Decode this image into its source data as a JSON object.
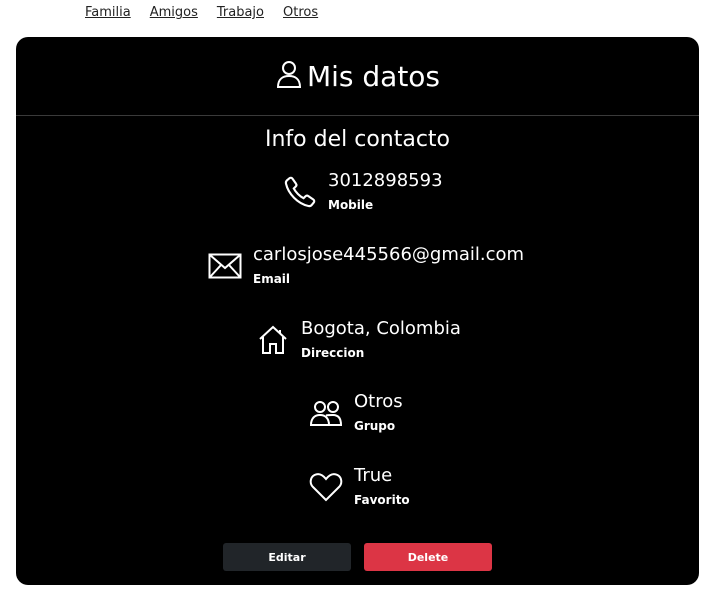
{
  "nav": {
    "links": [
      "Familia",
      "Amigos",
      "Trabajo",
      "Otros"
    ]
  },
  "card": {
    "title": "Mis datos",
    "section_title": "Info del contacto",
    "fields": {
      "phone": {
        "value": "3012898593",
        "label": "Mobile",
        "icon": "phone-icon"
      },
      "email": {
        "value": "carlosjose445566@gmail.com",
        "label": "Email",
        "icon": "envelope-icon"
      },
      "address": {
        "value": "Bogota, Colombia",
        "label": "Direccion",
        "icon": "house-icon"
      },
      "group": {
        "value": "Otros",
        "label": "Grupo",
        "icon": "people-icon"
      },
      "favorite": {
        "value": "True",
        "label": "Favorito",
        "icon": "heart-icon"
      }
    },
    "buttons": {
      "edit": "Editar",
      "delete": "Delete"
    }
  },
  "colors": {
    "card_bg": "#000000",
    "edit_button": "#212529",
    "delete_button": "#dc3545"
  }
}
